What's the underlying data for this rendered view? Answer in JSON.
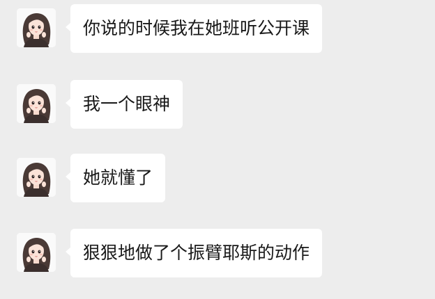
{
  "chat": {
    "messages": [
      {
        "sender_avatar": "girl-avatar",
        "text": "你说的时候我在她班听公开课"
      },
      {
        "sender_avatar": "girl-avatar",
        "text": "我一个眼神"
      },
      {
        "sender_avatar": "girl-avatar",
        "text": "她就懂了"
      },
      {
        "sender_avatar": "girl-avatar",
        "text": "狠狠地做了个振臂耶斯的动作"
      }
    ]
  },
  "colors": {
    "background": "#ededed",
    "bubble": "#ffffff",
    "text": "#191919"
  }
}
